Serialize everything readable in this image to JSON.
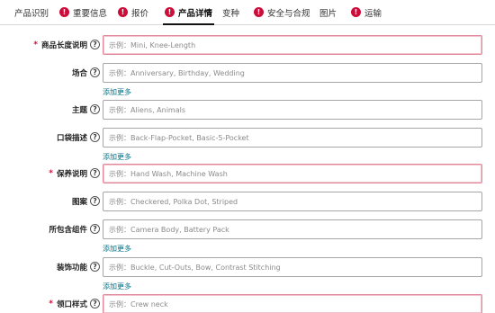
{
  "tabs": [
    {
      "label": "产品识别",
      "alert": false,
      "active": false
    },
    {
      "label": "重要信息",
      "alert": true,
      "active": false
    },
    {
      "label": "报价",
      "alert": true,
      "active": false
    },
    {
      "label": "产品详情",
      "alert": true,
      "active": true
    },
    {
      "label": "变种",
      "alert": false,
      "active": false
    },
    {
      "label": "安全与合规",
      "alert": true,
      "active": false
    },
    {
      "label": "图片",
      "alert": false,
      "active": false
    },
    {
      "label": "运输",
      "alert": true,
      "active": false
    }
  ],
  "alert_glyph": "!",
  "required_mark": "*",
  "help_glyph": "?",
  "add_more_label": "添加更多",
  "colors": {
    "alert": "#cc0c39",
    "link": "#007185",
    "error_border": "#e0899d"
  },
  "fields": [
    {
      "label": "商品长度说明",
      "required": true,
      "placeholder": "示例：Mini, Knee-Length",
      "add_more": false,
      "error": true
    },
    {
      "label": "场合",
      "required": false,
      "placeholder": "示例：Anniversary, Birthday, Wedding",
      "add_more": true,
      "error": false
    },
    {
      "label": "主题",
      "required": false,
      "placeholder": "示例：Aliens, Animals",
      "add_more": false,
      "error": false
    },
    {
      "label": "口袋描述",
      "required": false,
      "placeholder": "示例：Back-Flap-Pocket, Basic-5-Pocket",
      "add_more": true,
      "error": false
    },
    {
      "label": "保养说明",
      "required": true,
      "placeholder": "示例：Hand Wash, Machine Wash",
      "add_more": false,
      "error": true
    },
    {
      "label": "图案",
      "required": false,
      "placeholder": "示例：Checkered, Polka Dot, Striped",
      "add_more": false,
      "error": false
    },
    {
      "label": "所包含组件",
      "required": false,
      "placeholder": "示例：Camera Body, Battery Pack",
      "add_more": true,
      "error": false
    },
    {
      "label": "装饰功能",
      "required": false,
      "placeholder": "示例：Buckle, Cut-Outs, Bow, Contrast Stitching",
      "add_more": true,
      "error": false
    },
    {
      "label": "领口样式",
      "required": true,
      "placeholder": "示例：Crew neck",
      "add_more": false,
      "error": true
    }
  ]
}
